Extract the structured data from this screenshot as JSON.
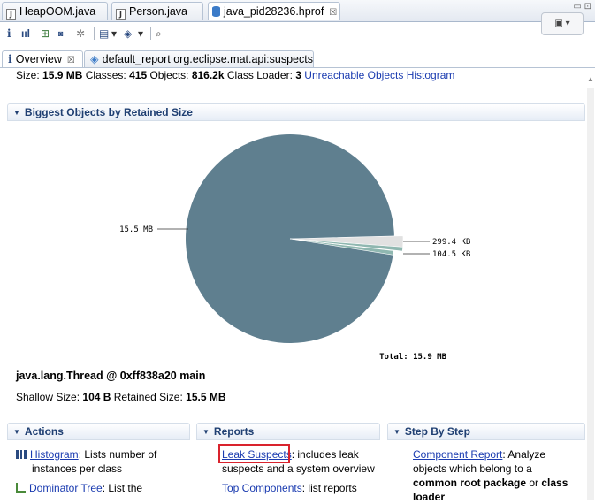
{
  "editor_tabs": [
    {
      "label": "HeapOOM.java",
      "icon": "java-file-icon",
      "active": false
    },
    {
      "label": "Person.java",
      "icon": "java-file-icon",
      "active": false
    },
    {
      "label": "java_pid28236.hprof",
      "icon": "heap-dump-icon",
      "active": true,
      "close": "☒"
    }
  ],
  "toolbar": {
    "info": "i",
    "histogram": "ııl",
    "dropdown": "▾",
    "search": "🔍"
  },
  "sub_tabs": [
    {
      "label": "Overview",
      "icon": "info-icon",
      "close": "☒"
    },
    {
      "label": "default_report  org.eclipse.mat.api:suspects",
      "icon": "report-icon"
    }
  ],
  "summary": {
    "size_label": "Size:",
    "size": "15.9 MB",
    "classes_label": "Classes:",
    "classes": "415",
    "objects_label": "Objects:",
    "objects": "816.2k",
    "loader_label": "Class Loader:",
    "loader": "3",
    "link": "Unreachable Objects Histogram"
  },
  "biggest_objects": {
    "title": "Biggest Objects by Retained Size"
  },
  "chart_data": {
    "type": "pie",
    "slices": [
      {
        "label": "15.5 MB",
        "value": 15.5,
        "color": "#5f7f8f"
      },
      {
        "label": "299.4 KB",
        "value": 0.2924,
        "color": "#e1e1e1"
      },
      {
        "label": "104.5 KB",
        "value": 0.1021,
        "color": "#8fb7b0"
      }
    ],
    "total_label": "Total: 15.9 MB"
  },
  "selection": {
    "thread": "java.lang.Thread @ 0xff838a20 main",
    "shallow_label": "Shallow Size:",
    "shallow": "104 B",
    "retained_label": "Retained Size:",
    "retained": "15.5 MB"
  },
  "actions": {
    "title": "Actions",
    "items": [
      {
        "link": "Histogram",
        "text1": ": Lists number of",
        "text2": "instances per class"
      },
      {
        "link": "Dominator Tree",
        "text1": ": List the"
      }
    ]
  },
  "reports": {
    "title": "Reports",
    "items": [
      {
        "link": "Leak Suspects",
        "text1": ": includes leak",
        "text2": "suspects and a system overview"
      },
      {
        "link": "Top Components",
        "text1": ": list reports"
      }
    ]
  },
  "step_by_step": {
    "title": "Step By Step",
    "link": "Component Report",
    "text1": ": Analyze",
    "text2": "objects which belong to a",
    "bold1": "common root package",
    "or": " or ",
    "bold2": "class",
    "bold3": "loader"
  }
}
